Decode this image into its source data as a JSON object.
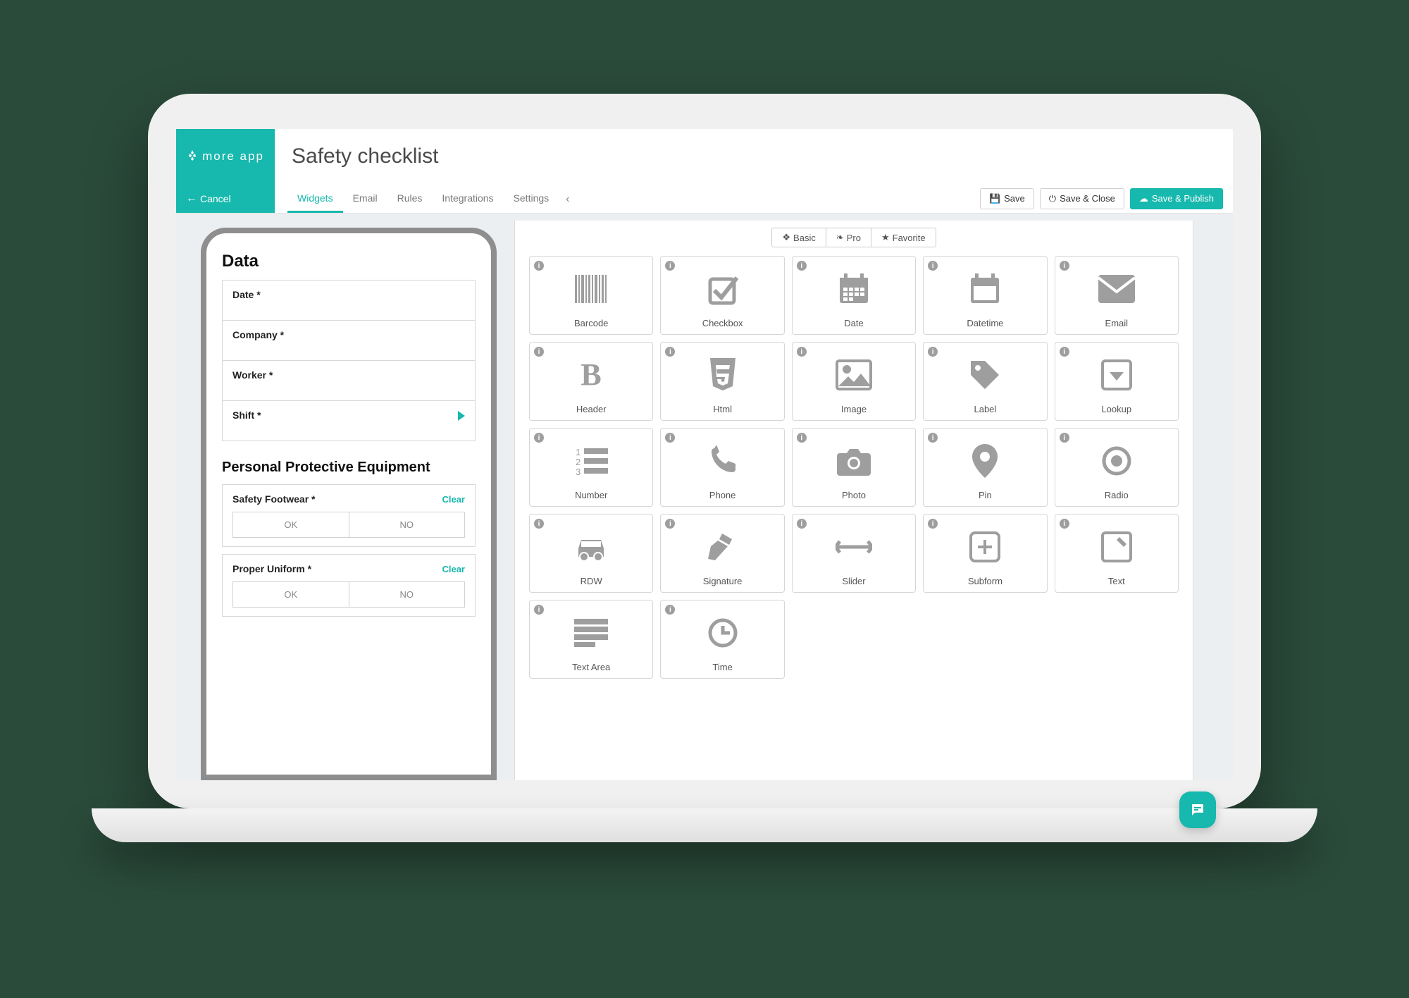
{
  "brand": "more app",
  "page_title": "Safety checklist",
  "cancel_label": "Cancel",
  "tabs": {
    "widgets": "Widgets",
    "email": "Email",
    "rules": "Rules",
    "integrations": "Integrations",
    "settings": "Settings"
  },
  "actions": {
    "save": "Save",
    "save_close": "Save & Close",
    "save_publish": "Save & Publish"
  },
  "preview": {
    "section1": "Data",
    "fields": {
      "date": "Date *",
      "company": "Company *",
      "worker": "Worker *",
      "shift": "Shift *"
    },
    "section2": "Personal Protective Equipment",
    "q1": "Safety Footwear *",
    "q2": "Proper Uniform *",
    "clear": "Clear",
    "ok": "OK",
    "no": "NO"
  },
  "filters": {
    "basic": "Basic",
    "pro": "Pro",
    "favorite": "Favorite"
  },
  "widgets": [
    {
      "id": "barcode",
      "label": "Barcode"
    },
    {
      "id": "checkbox",
      "label": "Checkbox"
    },
    {
      "id": "date",
      "label": "Date"
    },
    {
      "id": "datetime",
      "label": "Datetime"
    },
    {
      "id": "email",
      "label": "Email"
    },
    {
      "id": "header",
      "label": "Header"
    },
    {
      "id": "html",
      "label": "Html"
    },
    {
      "id": "image",
      "label": "Image"
    },
    {
      "id": "label",
      "label": "Label"
    },
    {
      "id": "lookup",
      "label": "Lookup"
    },
    {
      "id": "number",
      "label": "Number"
    },
    {
      "id": "phone",
      "label": "Phone"
    },
    {
      "id": "photo",
      "label": "Photo"
    },
    {
      "id": "pin",
      "label": "Pin"
    },
    {
      "id": "radio",
      "label": "Radio"
    },
    {
      "id": "rdw",
      "label": "RDW"
    },
    {
      "id": "signature",
      "label": "Signature"
    },
    {
      "id": "slider",
      "label": "Slider"
    },
    {
      "id": "subform",
      "label": "Subform"
    },
    {
      "id": "text",
      "label": "Text"
    },
    {
      "id": "textarea",
      "label": "Text Area"
    },
    {
      "id": "time",
      "label": "Time"
    }
  ]
}
